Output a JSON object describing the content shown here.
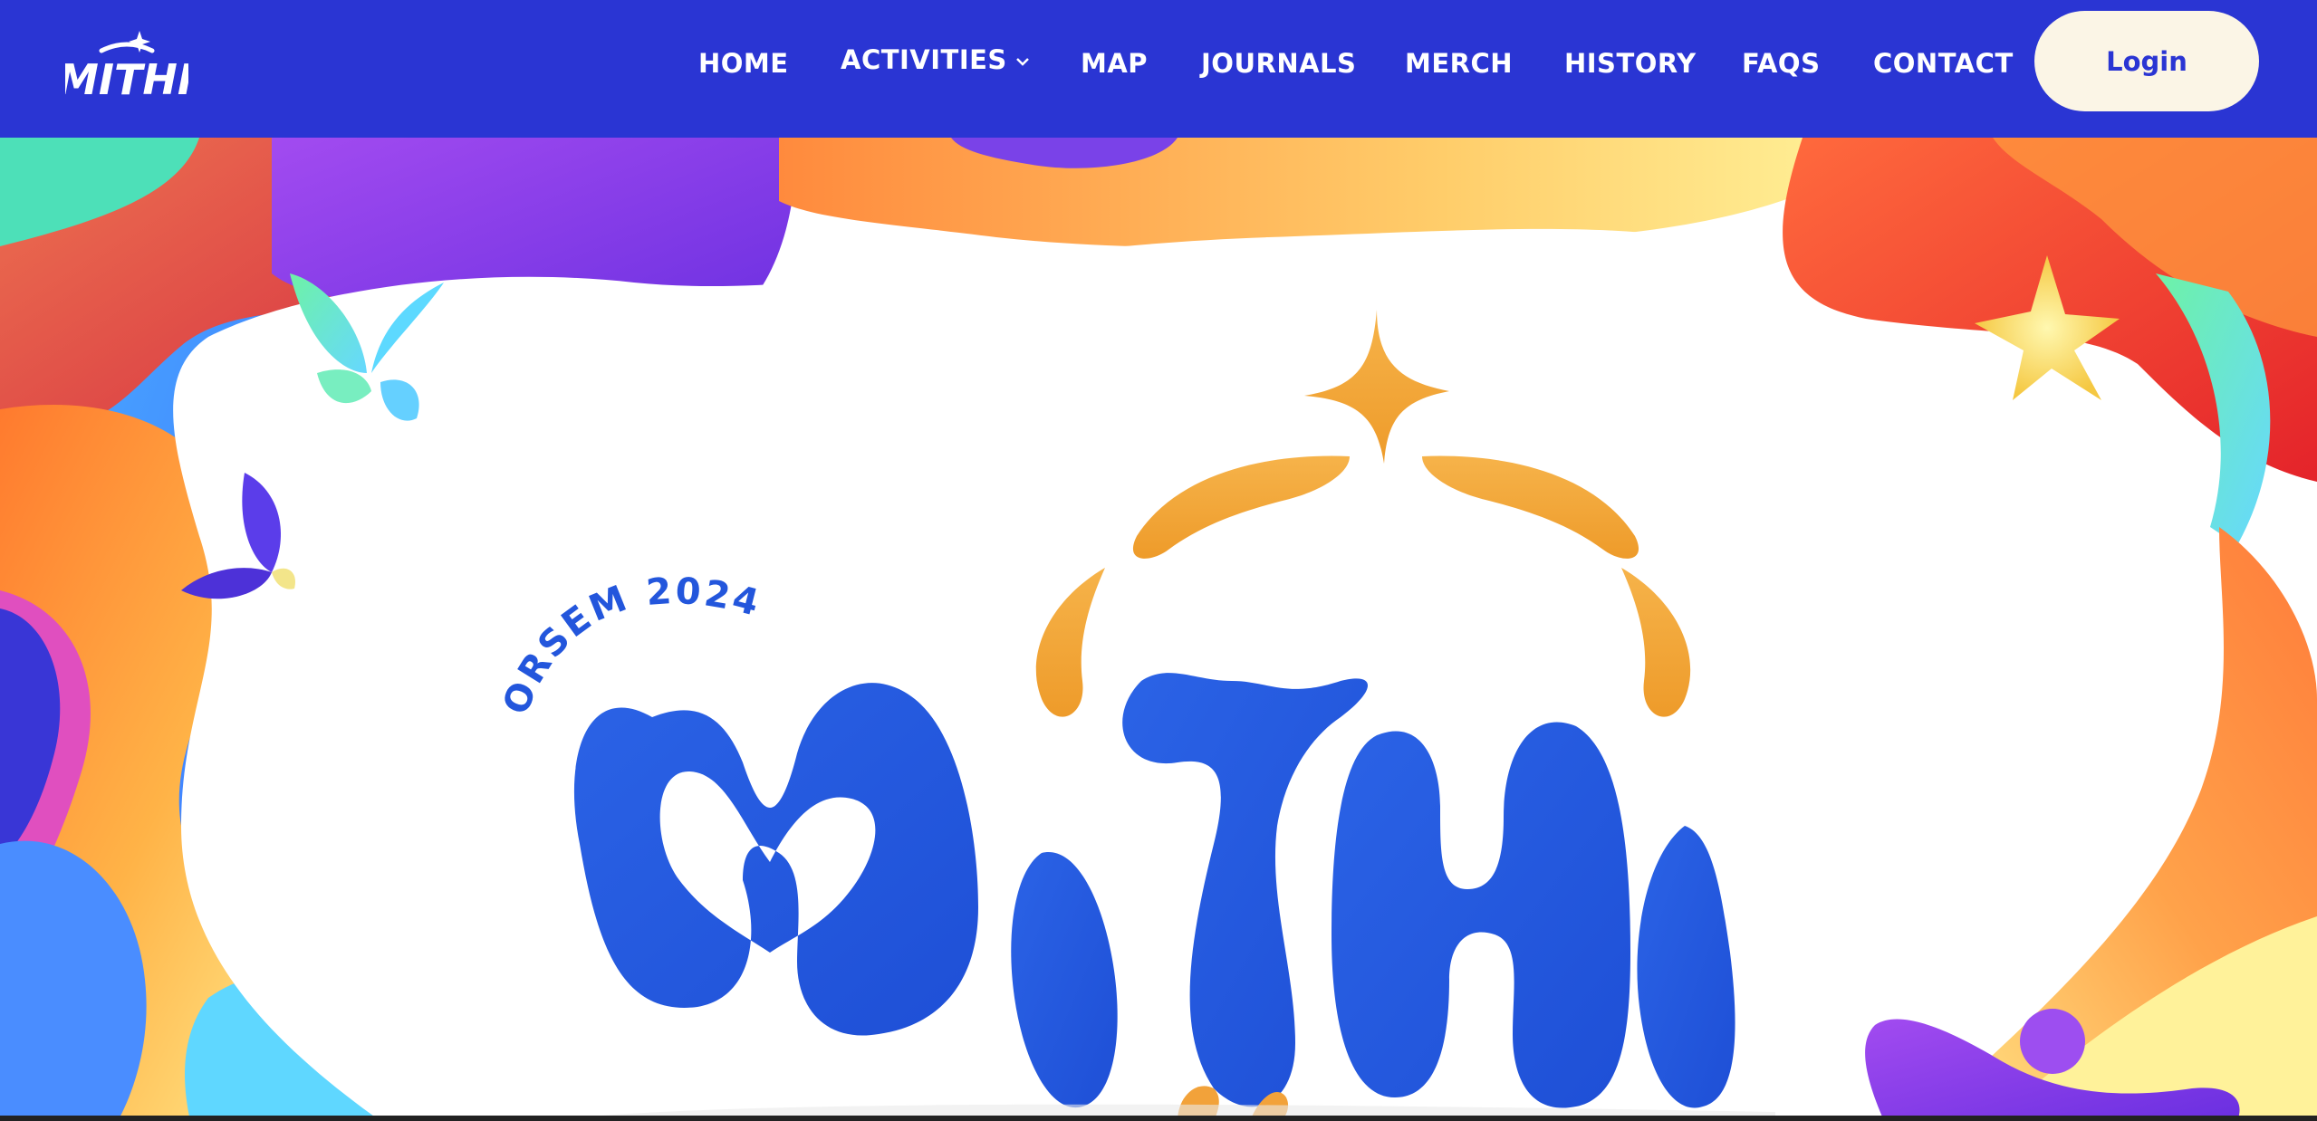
{
  "nav": {
    "logo_text": "MITHI",
    "items": [
      {
        "label": "HOME"
      },
      {
        "label": "ACTIVITIES",
        "has_dropdown": true
      },
      {
        "label": "MAP"
      },
      {
        "label": "JOURNALS"
      },
      {
        "label": "MERCH"
      },
      {
        "label": "HISTORY"
      },
      {
        "label": "FAQS"
      },
      {
        "label": "CONTACT"
      }
    ],
    "login_label": "Login"
  },
  "hero": {
    "subtitle": "ORSEM 2024",
    "title": "MITHI"
  },
  "colors": {
    "nav_bg": "#2a35d3",
    "login_bg": "#fbf5e6",
    "title_blue": "#2356dc",
    "accent_gold": "#f2a23a"
  }
}
